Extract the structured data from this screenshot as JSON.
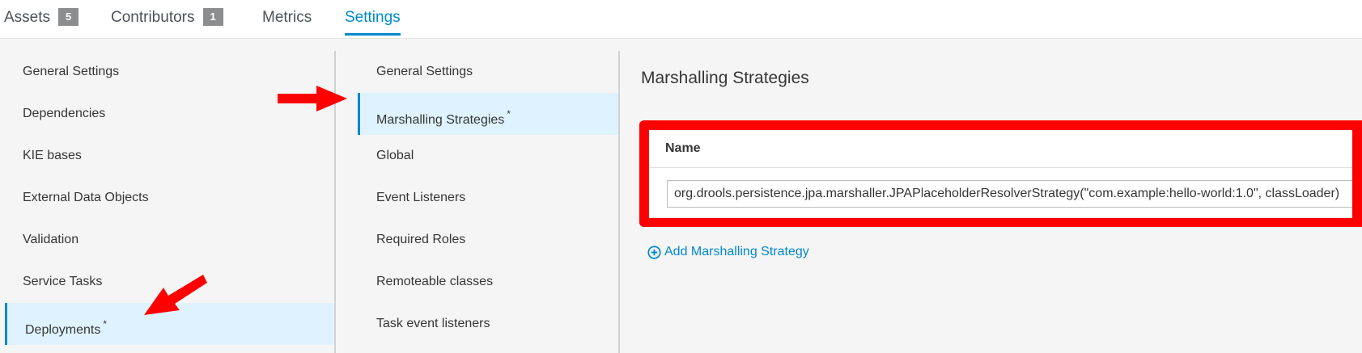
{
  "tabs": [
    {
      "label": "Assets",
      "badge": "5"
    },
    {
      "label": "Contributors",
      "badge": "1"
    },
    {
      "label": "Metrics"
    },
    {
      "label": "Settings"
    }
  ],
  "settings_nav": {
    "items": [
      {
        "label": "General Settings"
      },
      {
        "label": "Dependencies"
      },
      {
        "label": "KIE bases"
      },
      {
        "label": "External Data Objects"
      },
      {
        "label": "Validation"
      },
      {
        "label": "Service Tasks"
      },
      {
        "label": "Deployments",
        "marker": "*"
      }
    ]
  },
  "deployments_nav": {
    "items": [
      {
        "label": "General Settings"
      },
      {
        "label": "Marshalling Strategies",
        "marker": "*"
      },
      {
        "label": "Global"
      },
      {
        "label": "Event Listeners"
      },
      {
        "label": "Required Roles"
      },
      {
        "label": "Remoteable classes"
      },
      {
        "label": "Task event listeners"
      }
    ]
  },
  "content": {
    "title": "Marshalling Strategies",
    "table": {
      "column_header": "Name",
      "rows": [
        {
          "value": "org.drools.persistence.jpa.marshaller.JPAPlaceholderResolverStrategy(\"com.example:hello-world:1.0\", classLoader)"
        }
      ]
    },
    "add_label": "Add Marshalling Strategy"
  },
  "icons": {
    "add": "plus-circle-icon",
    "annotation_arrows": "arrow-icon"
  },
  "colors": {
    "accent": "#0088ce",
    "active_bg": "#def3ff",
    "annotation": "#ff0000"
  }
}
